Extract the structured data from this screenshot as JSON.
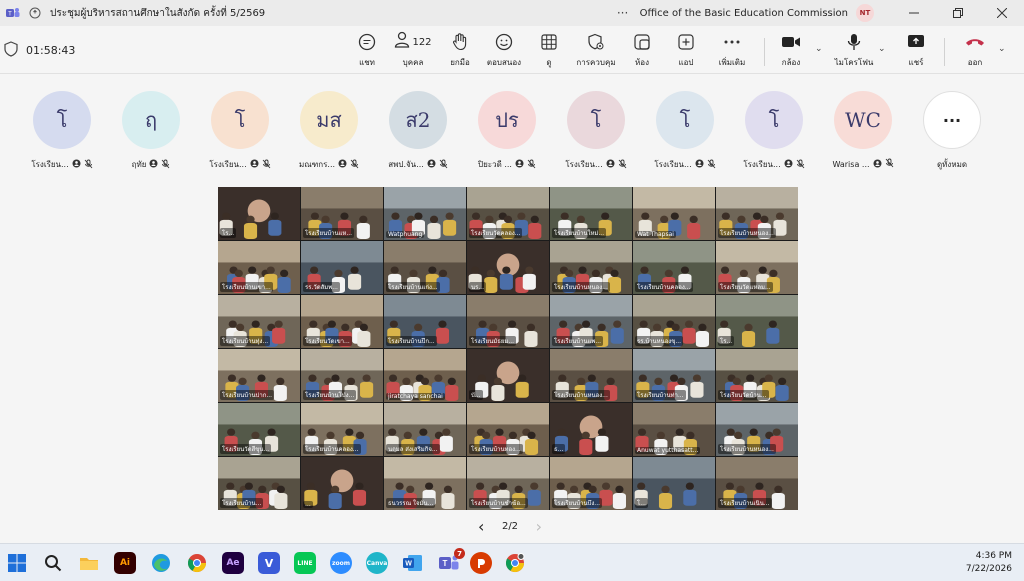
{
  "titlebar": {
    "title": "ประชุมผู้บริหารสถานศึกษาในสังกัด ครั้งที่ 5/2569",
    "more": "···",
    "org": "Office of the Basic Education Commission",
    "user_initials": "NT"
  },
  "toolbar": {
    "timer": "01:58:43",
    "people_count": "122",
    "chat": "แชท",
    "people": "บุคคล",
    "raise": "ยกมือ",
    "react": "ตอบสนอง",
    "view": "ดู",
    "controls": "การควบคุม",
    "rooms": "ห้อง",
    "apps": "แอป",
    "more": "เพิ่มเติม",
    "camera": "กล้อง",
    "mic": "ไมโครโฟน",
    "share": "แชร์",
    "leave": "ออก"
  },
  "participants": [
    {
      "initials": "โ",
      "name": "โรงเรียน...",
      "color": "#d5dbef"
    },
    {
      "initials": "ฤ",
      "name": "ฤทัย",
      "color": "#d8eef0"
    },
    {
      "initials": "โ",
      "name": "โรงเรียน...",
      "color": "#f8e1d0"
    },
    {
      "initials": "มส",
      "name": "มณฑกร...",
      "color": "#f7ebcc"
    },
    {
      "initials": "ส2",
      "name": "สพป.จัน...",
      "color": "#d4dde3"
    },
    {
      "initials": "ปร",
      "name": "ปิยะวดี ...",
      "color": "#f7d9d9"
    },
    {
      "initials": "โ",
      "name": "โรงเรียน...",
      "color": "#ead8dc"
    },
    {
      "initials": "โ",
      "name": "โรงเรียน...",
      "color": "#dce6ee"
    },
    {
      "initials": "โ",
      "name": "โรงเรียน...",
      "color": "#e0ddef"
    },
    {
      "initials": "WC",
      "name": "Warisa ...",
      "color": "#f8dcd7"
    }
  ],
  "view_all": {
    "label": "ดูทั้งหมด",
    "dots": "···"
  },
  "video_tiles": [
    "โร...",
    "โรงเรียนบ้านแห...",
    "Watphuang",
    "โรงเรียนวัดคลอง...",
    "โรงเรียนบ้านใหม่...",
    "Wat Thapsai",
    "โรงเรียนบ้านหนอง...",
    "โรงเรียนบ้านเขา...",
    "รร.วัดสัมพ...",
    "โรงเรียนบ้านแก่ง...",
    "นร...",
    "โรงเรียนบ้านหนอง...",
    "โรงเรียนบ้านคลอง...",
    "โรงเรียนวัดแหลม...",
    "โรงเรียนบ้านทุ่ง...",
    "โรงเรียนวัดเขา...",
    "โรงเรียนบ้านปึก...",
    "โรงเรียนมัธยม...",
    "โรงเรียนบ้านแพ...",
    "รร.บ้านหนองขุ...",
    "โร...",
    "โรงเรียนบ้านปาก...",
    "โรงเรียนบ้านโป่ง...",
    "jiratchaya sanchai",
    "บั...",
    "โรงเรียนบ้านหนอง...",
    "โรงเรียนบ้านท่า...",
    "โรงเรียนวัดบ้าน...",
    "โรงเรียนวัดสีขุน...",
    "โรงเรียนบ้านคลอง...",
    "นฤมล ส่งเสริมกิจ...",
    "โรงเรียนบ้านทอง...",
    "ธ...",
    "Anuwat yutthasatt...",
    "โรงเรียนบ้านหนอง...",
    "โรงเรียนบ้าน...",
    "...",
    "ธนวรรณ ใจมั่น...",
    "โรงเรียนบ้านชำฆ้อ...",
    "โรงเรียนบ้านบึง...",
    "โ...",
    "โรงเรียนบ้านเนิน..."
  ],
  "pager": {
    "label": "2/2",
    "prev": "‹",
    "next": "›"
  },
  "taskbar": {
    "time": "4:36 PM",
    "date": "7/22/2026",
    "teams_badge": "7",
    "apps": [
      "Ai",
      "Ae",
      "V",
      "LINE",
      "zoom",
      "Canva"
    ]
  },
  "colors": {
    "accent": "#5b5fc7",
    "leave": "#c4314b"
  }
}
